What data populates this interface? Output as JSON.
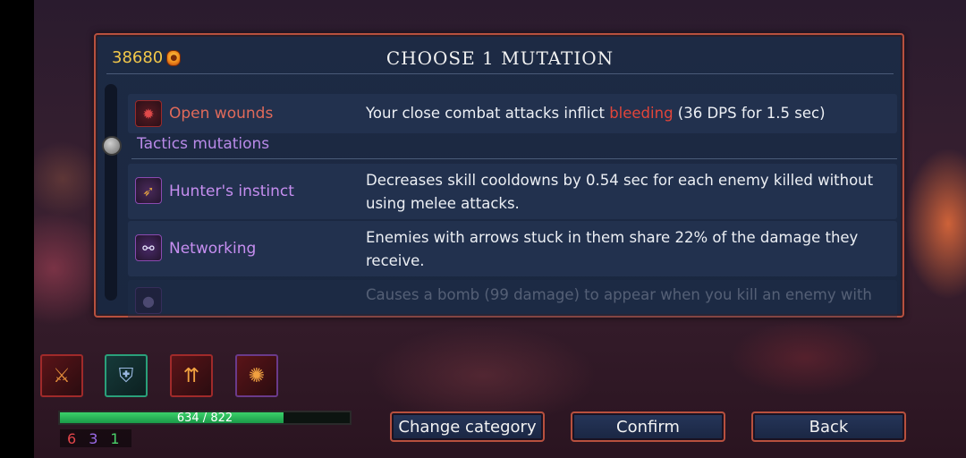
{
  "header": {
    "gold": "38680",
    "title": "CHOOSE 1 MUTATION"
  },
  "mutations": [
    {
      "name": "Open wounds",
      "icon": "bleeding-wound-icon",
      "desc_before": "Your close combat attacks inflict ",
      "desc_highlight": "bleeding",
      "desc_after": " (36 DPS for 1.5 sec)"
    },
    {
      "name": "Hunter's instinct",
      "icon": "crossed-arrows-icon",
      "desc": "Decreases skill cooldowns by 0.54 sec for each enemy killed without using melee attacks."
    },
    {
      "name": "Networking",
      "icon": "network-link-icon",
      "desc": "Enemies with arrows stuck in them share 22% of the damage they receive."
    },
    {
      "name": "",
      "icon": "bomb-icon",
      "desc": "Causes a bomb (99 damage) to appear when you kill an enemy with"
    }
  ],
  "section": {
    "label": "Tactics mutations"
  },
  "inventory": [
    {
      "icon": "sword-weapon-icon"
    },
    {
      "icon": "shield-icon"
    },
    {
      "icon": "turret-skill-icon"
    },
    {
      "icon": "fire-skill-icon"
    }
  ],
  "health": {
    "text": "634 / 822",
    "current": 634,
    "max": 822
  },
  "stats": {
    "brutality": "6",
    "tactics": "3",
    "survival": "1"
  },
  "buttons": {
    "change_category": "Change category",
    "confirm": "Confirm",
    "back": "Back"
  },
  "colors": {
    "accent_border": "#b8503e",
    "mutation_name": "#c68ef0",
    "highlight_red": "#e2453a",
    "gold": "#f3c84a",
    "health": "#3ad26a"
  }
}
